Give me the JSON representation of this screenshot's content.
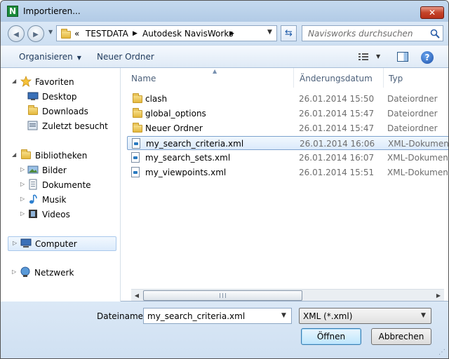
{
  "window": {
    "title": "Importieren...",
    "app_icon_letter": "N",
    "close_glyph": "✕"
  },
  "navigation": {
    "back_glyph": "◀",
    "forward_glyph": "▶",
    "breadcrumb": [
      {
        "label": "«"
      },
      {
        "label": "TESTDATA"
      },
      {
        "label": "Autodesk NavisWorks"
      }
    ],
    "refresh_glyph": "⇆",
    "search_placeholder": "Navisworks durchsuchen"
  },
  "toolbar": {
    "organize_label": "Organisieren",
    "new_folder_label": "Neuer Ordner",
    "help_glyph": "?"
  },
  "sidebar": {
    "favorites": {
      "label": "Favoriten",
      "items": [
        "Desktop",
        "Downloads",
        "Zuletzt besucht"
      ]
    },
    "libraries": {
      "label": "Bibliotheken",
      "items": [
        "Bilder",
        "Dokumente",
        "Musik",
        "Videos"
      ]
    },
    "computer": {
      "label": "Computer",
      "selected": true
    },
    "network": {
      "label": "Netzwerk"
    }
  },
  "file_list": {
    "columns": [
      "Name",
      "Änderungsdatum",
      "Typ"
    ],
    "rows": [
      {
        "name": "clash",
        "date": "26.01.2014 15:50",
        "type": "Dateiordner",
        "kind": "folder",
        "selected": false
      },
      {
        "name": "global_options",
        "date": "26.01.2014 15:47",
        "type": "Dateiordner",
        "kind": "folder",
        "selected": false
      },
      {
        "name": "Neuer Ordner",
        "date": "26.01.2014 15:47",
        "type": "Dateiordner",
        "kind": "folder",
        "selected": false
      },
      {
        "name": "my_search_criteria.xml",
        "date": "26.01.2014 16:06",
        "type": "XML-Dokument",
        "kind": "xml",
        "selected": true
      },
      {
        "name": "my_search_sets.xml",
        "date": "26.01.2014 16:07",
        "type": "XML-Dokument",
        "kind": "xml",
        "selected": false
      },
      {
        "name": "my_viewpoints.xml",
        "date": "26.01.2014 15:51",
        "type": "XML-Dokument",
        "kind": "xml",
        "selected": false
      }
    ]
  },
  "footer": {
    "filename_label": "Dateiname:",
    "filename_value": "my_search_criteria.xml",
    "filetype_value": "XML (*.xml)",
    "open_label": "Öffnen",
    "cancel_label": "Abbrechen"
  }
}
